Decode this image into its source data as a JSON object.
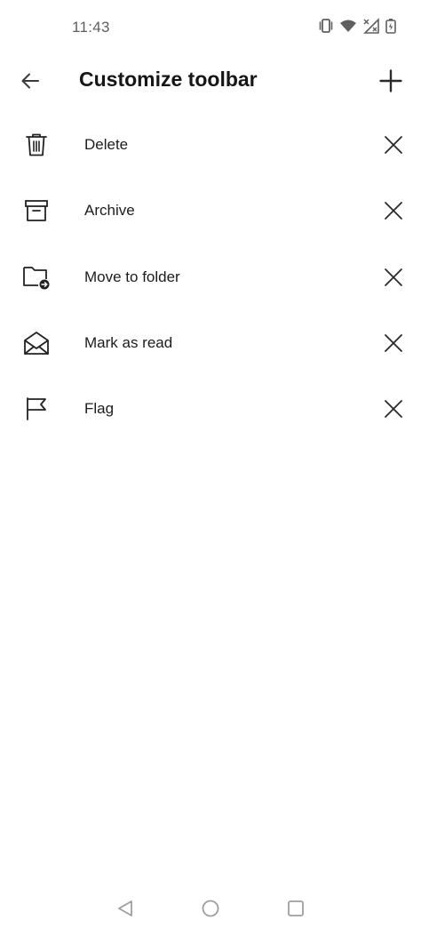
{
  "status_bar": {
    "time": "11:43",
    "icons": [
      "vibrate-icon",
      "wifi-icon",
      "no-signal-icon",
      "battery-charging-icon"
    ]
  },
  "app_bar": {
    "title": "Customize toolbar",
    "back_icon": "arrow-left-icon",
    "add_icon": "plus-icon"
  },
  "toolbar_items": [
    {
      "label": "Delete",
      "icon": "trash-icon"
    },
    {
      "label": "Archive",
      "icon": "archive-icon"
    },
    {
      "label": "Move to folder",
      "icon": "move-to-folder-icon"
    },
    {
      "label": "Mark as read",
      "icon": "mail-open-icon"
    },
    {
      "label": "Flag",
      "icon": "flag-icon"
    }
  ],
  "nav_bar": {
    "icons": [
      "nav-back-icon",
      "nav-home-icon",
      "nav-recents-icon"
    ]
  },
  "colors": {
    "background": "#ffffff",
    "text_primary": "#1a1a1a",
    "text_secondary": "#5f5f5f",
    "nav_icon": "#9e9e9e"
  }
}
